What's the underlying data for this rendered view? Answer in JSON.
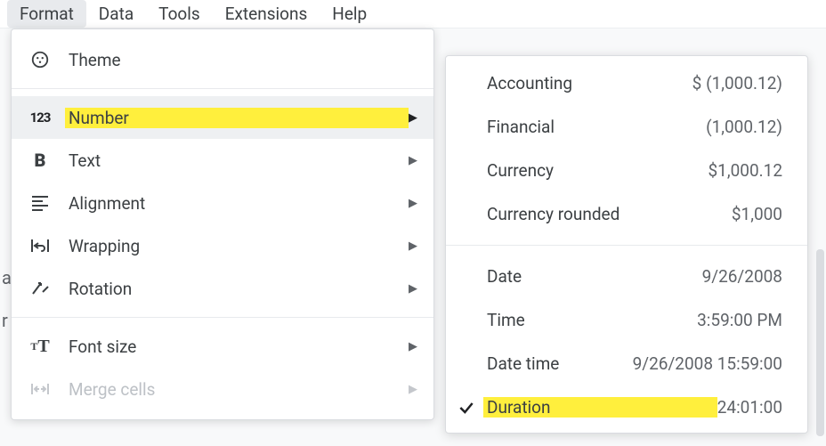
{
  "menubar": {
    "format": "Format",
    "data": "Data",
    "tools": "Tools",
    "extensions": "Extensions",
    "help": "Help"
  },
  "left_hints": {
    "a": "a",
    "r": "r"
  },
  "format_menu": {
    "theme": "Theme",
    "number": "Number",
    "text": "Text",
    "alignment": "Alignment",
    "wrapping": "Wrapping",
    "rotation": "Rotation",
    "font_size": "Font size",
    "merge_cells": "Merge cells"
  },
  "number_submenu": [
    {
      "label": "Accounting",
      "example": "$ (1,000.12)",
      "checked": false,
      "highlight": false
    },
    {
      "label": "Financial",
      "example": "(1,000.12)",
      "checked": false,
      "highlight": false
    },
    {
      "label": "Currency",
      "example": "$1,000.12",
      "checked": false,
      "highlight": false
    },
    {
      "label": "Currency rounded",
      "example": "$1,000",
      "checked": false,
      "highlight": false
    },
    {
      "sep": true
    },
    {
      "label": "Date",
      "example": "9/26/2008",
      "checked": false,
      "highlight": false
    },
    {
      "label": "Time",
      "example": "3:59:00 PM",
      "checked": false,
      "highlight": false
    },
    {
      "label": "Date time",
      "example": "9/26/2008 15:59:00",
      "checked": false,
      "highlight": false
    },
    {
      "label": "Duration",
      "example": "24:01:00",
      "checked": true,
      "highlight": true
    }
  ]
}
